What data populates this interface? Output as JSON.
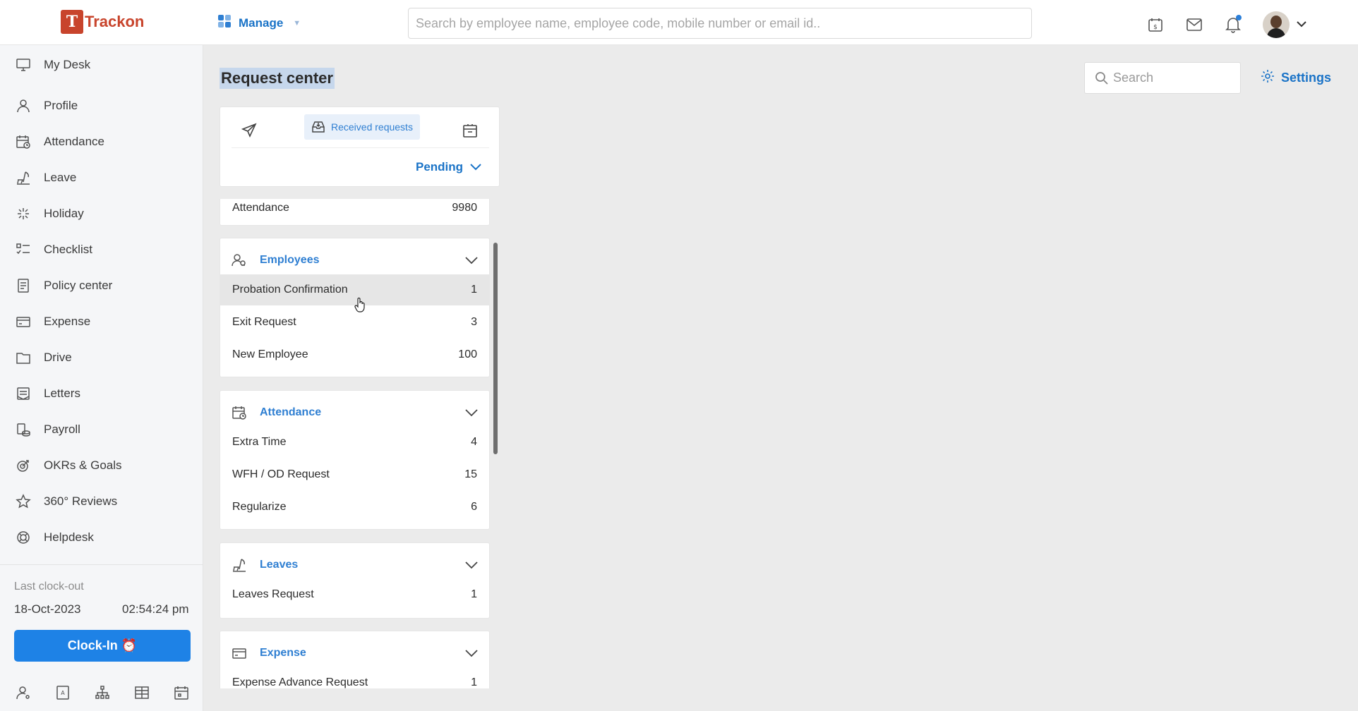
{
  "brand": {
    "name": "Trackon",
    "mark": "T"
  },
  "header": {
    "manage_label": "Manage",
    "search_placeholder": "Search by employee name, employee code, mobile number or email id.."
  },
  "sidebar": {
    "items": [
      {
        "label": "My Desk",
        "icon": "monitor-icon"
      },
      {
        "label": "Profile",
        "icon": "user-icon"
      },
      {
        "label": "Attendance",
        "icon": "calendar-clock-icon"
      },
      {
        "label": "Leave",
        "icon": "beach-icon"
      },
      {
        "label": "Holiday",
        "icon": "sparkle-icon"
      },
      {
        "label": "Checklist",
        "icon": "checklist-icon"
      },
      {
        "label": "Policy center",
        "icon": "document-icon"
      },
      {
        "label": "Expense",
        "icon": "card-icon"
      },
      {
        "label": "Drive",
        "icon": "folder-icon"
      },
      {
        "label": "Letters",
        "icon": "letters-icon"
      },
      {
        "label": "Payroll",
        "icon": "coins-icon"
      },
      {
        "label": "OKRs & Goals",
        "icon": "target-icon"
      },
      {
        "label": "360° Reviews",
        "icon": "star-icon"
      },
      {
        "label": "Helpdesk",
        "icon": "lifebuoy-icon"
      }
    ],
    "clock": {
      "label": "Last clock-out",
      "date": "18-Oct-2023",
      "time": "02:54:24 pm",
      "button": "Clock-In ⏰"
    }
  },
  "main": {
    "title": "Request center",
    "search_placeholder": "Search",
    "settings_label": "Settings",
    "tabs": {
      "active": "Received requests"
    },
    "filter": "Pending",
    "partial_row": {
      "label": "Attendance",
      "count": "9980"
    },
    "sections": [
      {
        "title": "Employees",
        "icon": "employees-icon",
        "rows": [
          {
            "label": "Probation Confirmation",
            "count": "1"
          },
          {
            "label": "Exit Request",
            "count": "3"
          },
          {
            "label": "New Employee",
            "count": "100"
          }
        ]
      },
      {
        "title": "Attendance",
        "icon": "calendar-clock-icon",
        "rows": [
          {
            "label": "Extra Time",
            "count": "4"
          },
          {
            "label": "WFH / OD Request",
            "count": "15"
          },
          {
            "label": "Regularize",
            "count": "6"
          }
        ]
      },
      {
        "title": "Leaves",
        "icon": "beach-icon",
        "rows": [
          {
            "label": "Leaves Request",
            "count": "1"
          }
        ]
      },
      {
        "title": "Expense",
        "icon": "card-icon",
        "rows": [
          {
            "label": "Expense Advance Request",
            "count": "1"
          }
        ]
      }
    ]
  },
  "colors": {
    "accent": "#1a73c7",
    "button": "#1e82e6",
    "brand": "#c8442c"
  }
}
